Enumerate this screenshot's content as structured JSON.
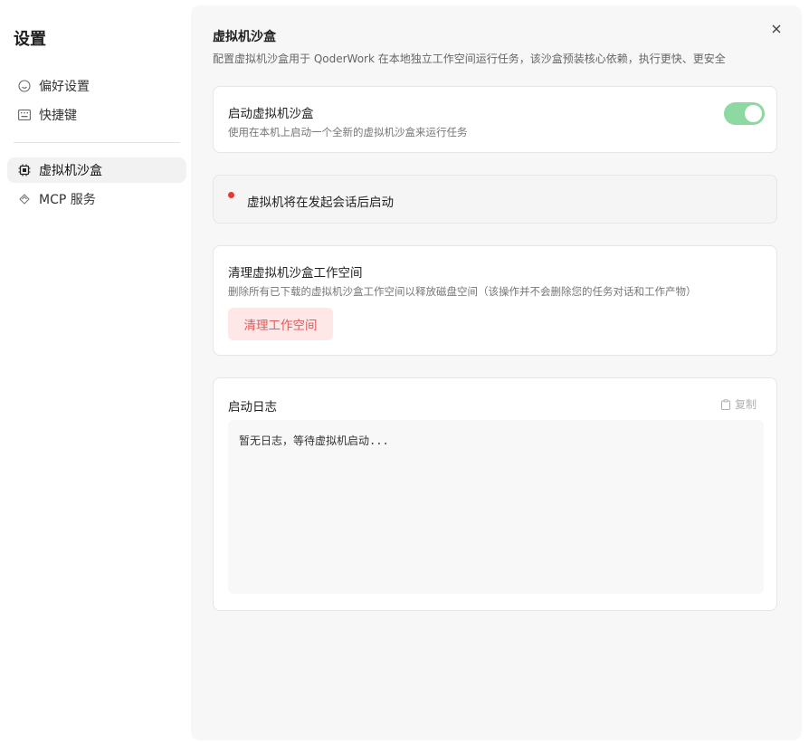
{
  "sidebar": {
    "title": "设置",
    "items": [
      {
        "label": "偏好设置",
        "icon": "smile-icon"
      },
      {
        "label": "快捷键",
        "icon": "keyboard-icon"
      },
      {
        "label": "虚拟机沙盒",
        "icon": "chip-icon",
        "active": true
      },
      {
        "label": "MCP 服务",
        "icon": "mcp-icon"
      }
    ]
  },
  "page": {
    "title": "虚拟机沙盒",
    "description": "配置虚拟机沙盒用于 QoderWork 在本地独立工作空间运行任务，该沙盒预装核心依赖，执行更快、更安全"
  },
  "enable_card": {
    "title": "启动虚拟机沙盒",
    "description": "使用在本机上启动一个全新的虚拟机沙盒来运行任务",
    "toggle_on": true
  },
  "status_card": {
    "text": "虚拟机将在发起会话后启动",
    "dot_color": "#e53935"
  },
  "clean_card": {
    "title": "清理虚拟机沙盒工作空间",
    "description": "删除所有已下载的虚拟机沙盒工作空间以释放磁盘空间（该操作并不会删除您的任务对话和工作产物）",
    "button_label": "清理工作空间"
  },
  "log_card": {
    "title": "启动日志",
    "copy_label": "复制",
    "log_text": "暂无日志，等待虚拟机启动..."
  },
  "colors": {
    "accent_toggle": "#8ed9a2",
    "danger": "#e25a5a",
    "danger_bg": "#fde7e7"
  }
}
